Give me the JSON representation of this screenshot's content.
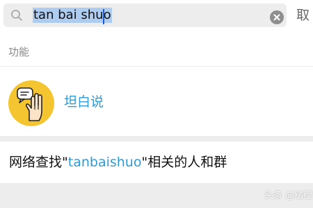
{
  "search": {
    "query": "tan bai shuo",
    "cancel_label": "取"
  },
  "section": {
    "label": "功能"
  },
  "result": {
    "title": "坦白说",
    "logo_bg_color": "#f5c431",
    "accent_color": "#2f9bd6"
  },
  "network_search": {
    "prefix": "网络查找\"",
    "keyword": "tanbaishuo",
    "suffix": "\"相关的人和群"
  },
  "watermark": {
    "text": "头条 @结缨"
  },
  "icons": {
    "search": "search-icon",
    "clear": "clear-icon",
    "logo": "hand-speech-bubble-icon"
  }
}
